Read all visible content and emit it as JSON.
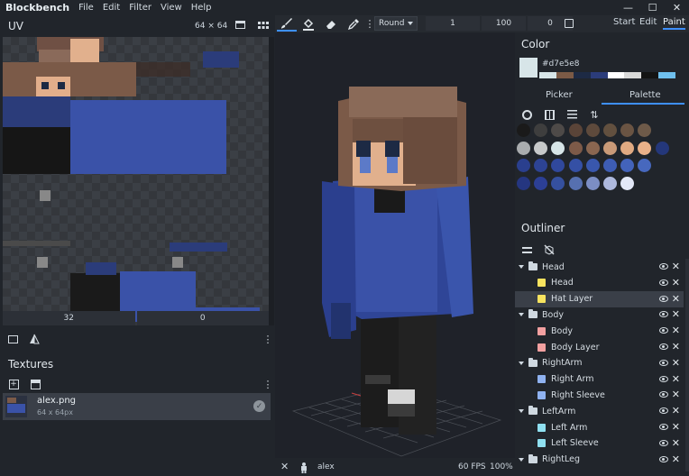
{
  "app": {
    "title": "Blockbench"
  },
  "menu": [
    "File",
    "Edit",
    "Filter",
    "View",
    "Help"
  ],
  "window_controls": {
    "minimize": "—",
    "maximize": "☐",
    "close": "✕"
  },
  "toolbar": {
    "brush_mode": "Round",
    "size": "1",
    "opacity": "100",
    "softness": "0",
    "modes": [
      "Start",
      "Edit",
      "Paint"
    ],
    "active_mode": "Paint"
  },
  "uv": {
    "title": "UV",
    "resolution": "64 × 64",
    "input_x": "32",
    "input_y": "0"
  },
  "textures": {
    "title": "Textures",
    "items": [
      {
        "name": "alex.png",
        "size": "64 x 64px"
      }
    ]
  },
  "viewport": {
    "fps": "60 FPS",
    "zoom": "100%",
    "model_name": "alex"
  },
  "color": {
    "title": "Color",
    "hex": "#d7e5e8",
    "tabs": [
      "Picker",
      "Palette"
    ],
    "active_tab": "Palette",
    "history": [
      "#d7e5e8",
      "#7b5a46",
      "#1d2a44",
      "#2b3c7a",
      "#ffffff",
      "#d9d9d9",
      "#141414",
      "#6fc0ee"
    ],
    "palette": [
      "#1a1a1a",
      "#3e3e3e",
      "#4e4a48",
      "#5a4438",
      "#5e4a3c",
      "#62503f",
      "#6a5443",
      "#6e5a49",
      "#a9acae",
      "#c7c9ca",
      "#d7e5e8",
      "#7d5a48",
      "#8a6650",
      "#c99a78",
      "#e0aa82",
      "#eab189",
      "#24377a",
      "#2a3f8e",
      "#2d4394",
      "#30489c",
      "#3550a5",
      "#3957ad",
      "#3e5db4",
      "#4363ba",
      "#4768be",
      "#253680",
      "#2c3f95",
      "#35509f",
      "#5670b0",
      "#7c8ec4",
      "#aeb9dd",
      "#e3e8f7"
    ]
  },
  "outliner": {
    "title": "Outliner",
    "rows": [
      {
        "label": "Head",
        "kind": "group",
        "indent": 0
      },
      {
        "label": "Head",
        "kind": "cube",
        "color": "#f7e35f",
        "indent": 1
      },
      {
        "label": "Hat Layer",
        "kind": "cube",
        "color": "#f7e35f",
        "indent": 1,
        "selected": true
      },
      {
        "label": "Body",
        "kind": "group",
        "indent": 0
      },
      {
        "label": "Body",
        "kind": "cube",
        "color": "#f2a0a0",
        "indent": 1
      },
      {
        "label": "Body Layer",
        "kind": "cube",
        "color": "#f2a0a0",
        "indent": 1
      },
      {
        "label": "RightArm",
        "kind": "group",
        "indent": 0
      },
      {
        "label": "Right Arm",
        "kind": "cube",
        "color": "#8fb2f0",
        "indent": 1
      },
      {
        "label": "Right Sleeve",
        "kind": "cube",
        "color": "#8fb2f0",
        "indent": 1
      },
      {
        "label": "LeftArm",
        "kind": "group",
        "indent": 0
      },
      {
        "label": "Left Arm",
        "kind": "cube",
        "color": "#8fe0f0",
        "indent": 1
      },
      {
        "label": "Left Sleeve",
        "kind": "cube",
        "color": "#8fe0f0",
        "indent": 1
      },
      {
        "label": "RightLeg",
        "kind": "group",
        "indent": 0
      }
    ]
  },
  "accent_color": "#3e90ff"
}
